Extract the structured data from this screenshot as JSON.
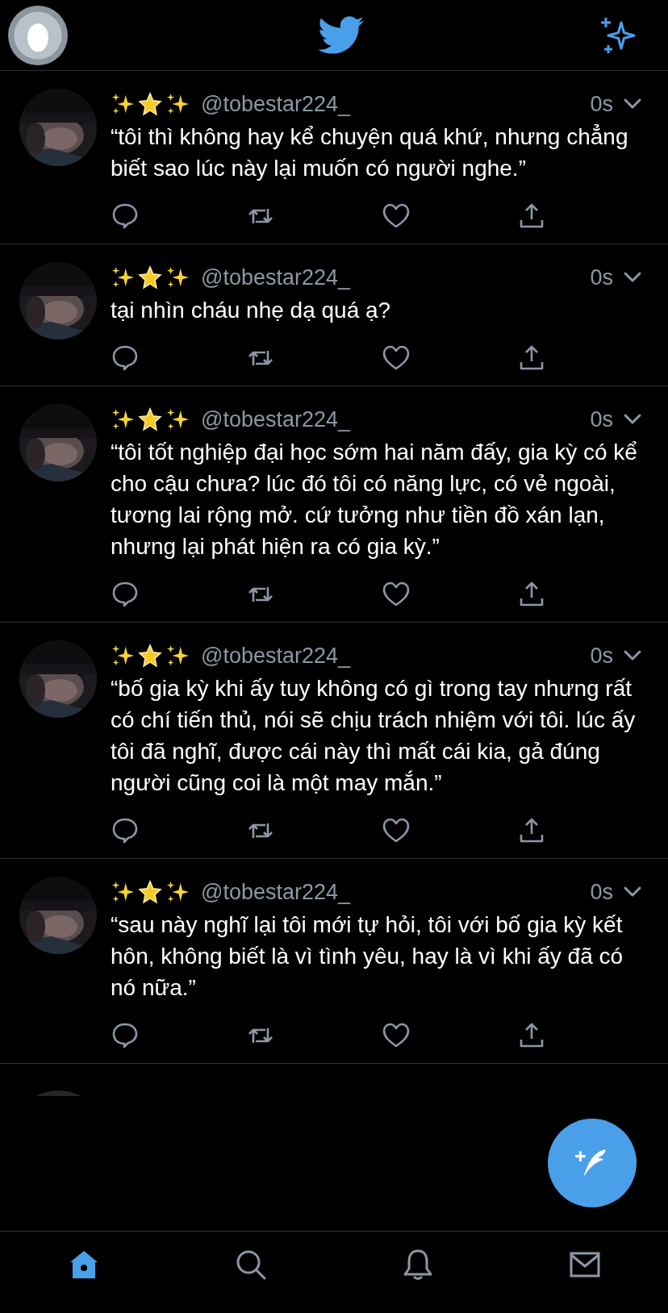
{
  "tweets": [
    {
      "handle": "@tobestar224_",
      "time": "0s",
      "text": "“tôi thì không hay kể chuyện quá khứ, nhưng chẳng biết sao lúc này lại muốn có người nghe.”"
    },
    {
      "handle": "@tobestar224_",
      "time": "0s",
      "text": "tại nhìn cháu nhẹ dạ quá ạ?"
    },
    {
      "handle": "@tobestar224_",
      "time": "0s",
      "text": "“tôi tốt nghiệp đại học sớm hai năm đấy, gia kỳ có kể cho cậu chưa? lúc đó tôi có năng lực, có vẻ ngoài, tương lai rộng mở. cứ tưởng như tiền đồ xán lạn, nhưng lại phát hiện ra có gia kỳ.”"
    },
    {
      "handle": "@tobestar224_",
      "time": "0s",
      "text": "“bố gia kỳ khi ấy tuy không có gì trong tay nhưng rất có chí tiến thủ, nói sẽ chịu trách nhiệm với tôi. lúc ấy tôi đã nghĩ, được cái này thì mất cái kia, gả đúng người cũng coi là một may mắn.”"
    },
    {
      "handle": "@tobestar224_",
      "time": "0s",
      "text": "“sau này nghĩ lại tôi mới tự hỏi, tôi với bố gia kỳ kết hôn, không biết là vì tình yêu, hay là vì khi ấy đã có nó nữa.”"
    }
  ],
  "tab_bar": [
    {
      "kind": "home",
      "selected": true
    },
    {
      "kind": "search",
      "selected": false
    },
    {
      "kind": "notifications",
      "selected": false
    },
    {
      "kind": "messages",
      "selected": false
    }
  ]
}
